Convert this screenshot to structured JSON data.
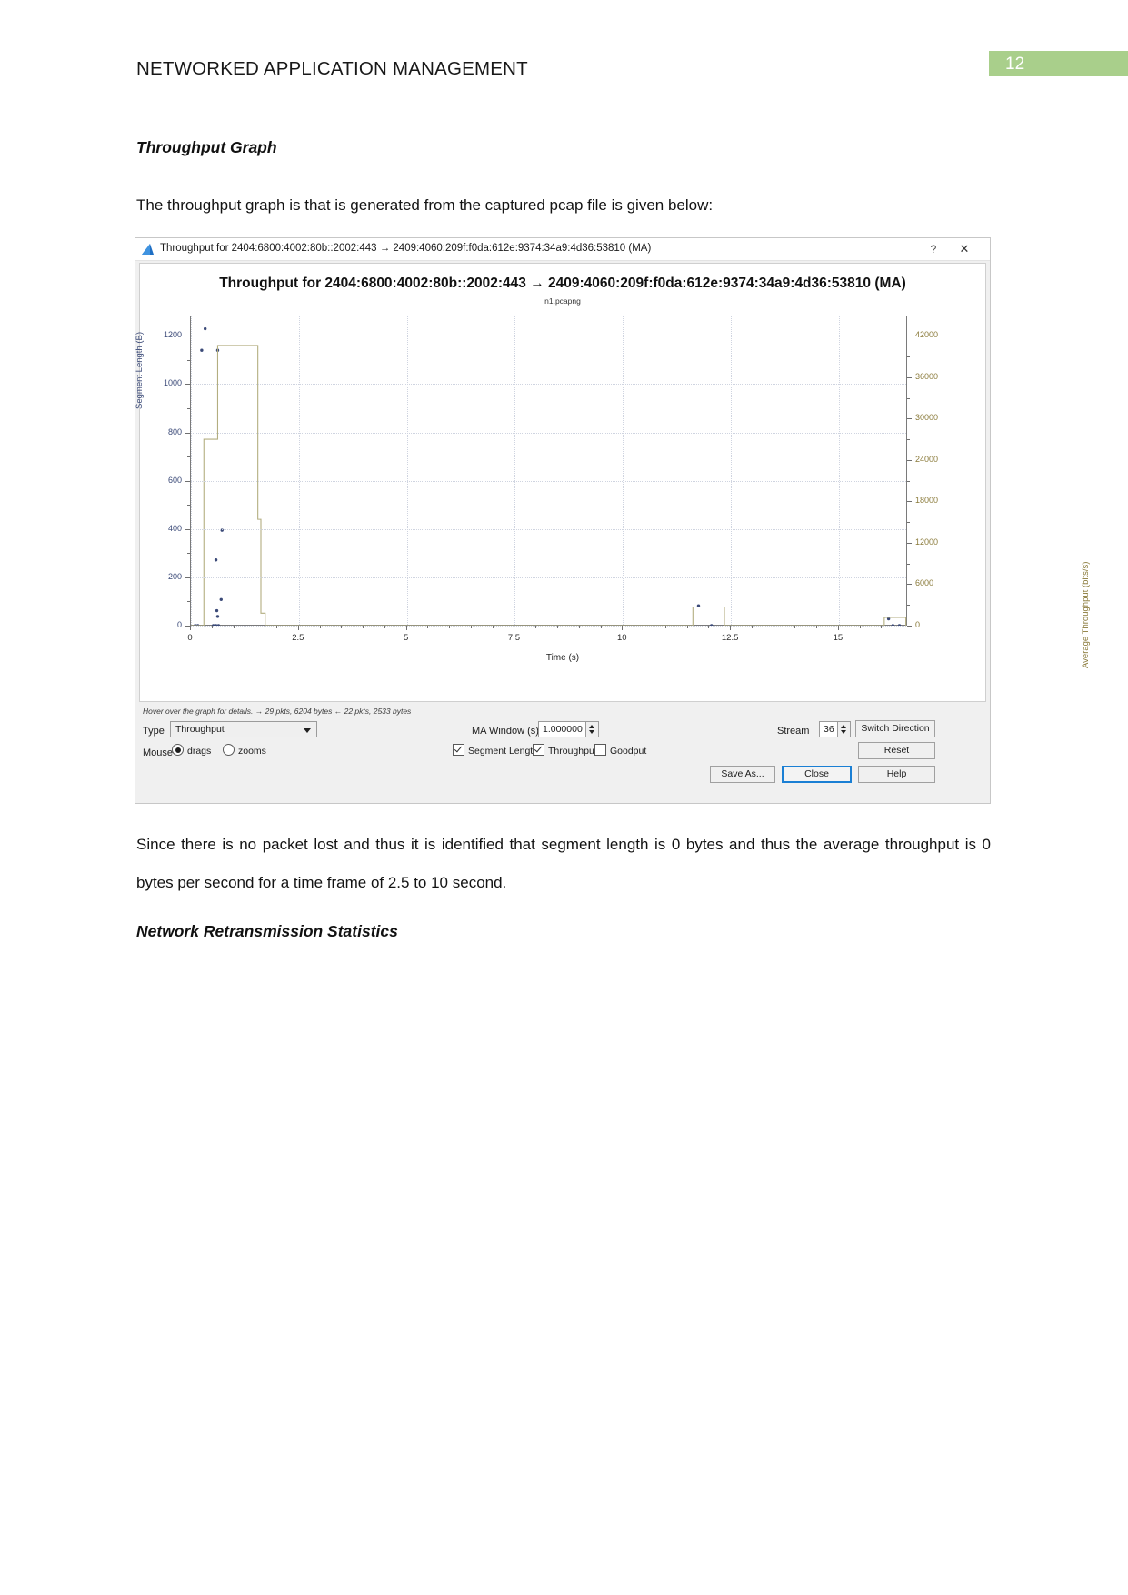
{
  "document": {
    "header_title": "NETWORKED APPLICATION MANAGEMENT",
    "page_number": "12",
    "accent_green": "#a9cf8b",
    "heading_throughput": "Throughput Graph",
    "para_intro": "The throughput graph is that is generated from the captured pcap file is given below:",
    "para_conclusion": "Since there is no packet lost and thus it is identified that segment length is 0 bytes and thus the average throughput is 0 bytes per second for a time frame of 2.5 to 10 second.",
    "heading_retransmission": "Network Retransmission Statistics"
  },
  "window": {
    "title": "Throughput for 2404:6800:4002:80b::2002:443 → 2409:4060:209f:f0da:612e:9374:34a9:4d36:53810 (MA)",
    "help_glyph": "?",
    "close_glyph": "✕",
    "hover_status": "Hover over the graph for details. → 29 pkts, 6204 bytes ← 22 pkts, 2533 bytes"
  },
  "controls": {
    "type_label": "Type",
    "type_value": "Throughput",
    "ma_window_label": "MA Window (s)",
    "ma_window_value": "1.000000",
    "stream_label": "Stream",
    "stream_value": "36",
    "switch_direction_label": "Switch Direction",
    "mouse_label": "Mouse",
    "mouse_drags_label": "drags",
    "mouse_zooms_label": "zooms",
    "mouse_mode": "drags",
    "check_segment_length_label": "Segment Length",
    "check_throughput_label": "Throughput",
    "check_goodput_label": "Goodput",
    "check_segment_length_on": true,
    "check_throughput_on": true,
    "check_goodput_on": false,
    "reset_label": "Reset",
    "save_as_label": "Save As...",
    "close_label": "Close",
    "help_label": "Help"
  },
  "chart_data": {
    "type": "line",
    "title": "Throughput for 2404:6800:4002:80b::2002:443 → 2409:4060:209f:f0da:612e:9374:34a9:4d36:53810 (MA)",
    "subtitle": "n1.pcapng",
    "xlabel": "Time (s)",
    "ylabel": "Segment Length (B)",
    "y2label": "Average Throughput (bits/s)",
    "xlim": [
      0,
      16.6
    ],
    "ylim": [
      0,
      1280
    ],
    "y2lim": [
      0,
      44800
    ],
    "xticks": [
      "0",
      "2.5",
      "5",
      "7.5",
      "10",
      "12.5",
      "15"
    ],
    "xtick_values": [
      0,
      2.5,
      5,
      7.5,
      10,
      12.5,
      15
    ],
    "yticks": [
      "0",
      "200",
      "400",
      "600",
      "800",
      "1000",
      "1200"
    ],
    "ytick_values": [
      0,
      200,
      400,
      600,
      800,
      1000,
      1200
    ],
    "y2ticks": [
      "0",
      "6000",
      "12000",
      "18000",
      "24000",
      "30000",
      "36000",
      "42000"
    ],
    "y2tick_values": [
      0,
      6000,
      12000,
      18000,
      24000,
      30000,
      36000,
      42000
    ],
    "grid": true,
    "legend": [
      "Segment Length",
      "Throughput",
      "Goodput"
    ],
    "series": [
      {
        "name": "Segment Length",
        "kind": "scatter",
        "color": "#3b4a78",
        "points": [
          [
            0.33,
            1229
          ],
          [
            0.25,
            1140
          ],
          [
            0.62,
            1140
          ],
          [
            0.72,
            395
          ],
          [
            0.58,
            272
          ],
          [
            0.7,
            108
          ],
          [
            0.6,
            62
          ],
          [
            0.62,
            38
          ],
          [
            0.1,
            0
          ],
          [
            0.16,
            0
          ],
          [
            0.52,
            0
          ],
          [
            0.58,
            0
          ],
          [
            0.64,
            0
          ],
          [
            11.75,
            82
          ],
          [
            12.05,
            0
          ],
          [
            16.15,
            28
          ],
          [
            16.25,
            0
          ],
          [
            16.4,
            0
          ]
        ]
      },
      {
        "name": "Throughput",
        "kind": "step",
        "color": "#b3ae80",
        "points": [
          [
            0.0,
            0
          ],
          [
            0.3,
            0
          ],
          [
            0.3,
            27000
          ],
          [
            0.62,
            27000
          ],
          [
            0.62,
            40600
          ],
          [
            1.55,
            40600
          ],
          [
            1.55,
            15400
          ],
          [
            1.62,
            15400
          ],
          [
            1.62,
            1800
          ],
          [
            1.72,
            1800
          ],
          [
            1.72,
            0
          ],
          [
            11.62,
            0
          ],
          [
            11.62,
            2700
          ],
          [
            12.35,
            2700
          ],
          [
            12.35,
            0
          ],
          [
            16.05,
            0
          ],
          [
            16.05,
            1200
          ],
          [
            16.55,
            1200
          ],
          [
            16.55,
            0
          ]
        ]
      }
    ],
    "notes": "Segment-length scatter (dark blue dots) with a moving-average throughput step line (olive). Long flat zero region between roughly 2.5 s and 11.6 s."
  }
}
